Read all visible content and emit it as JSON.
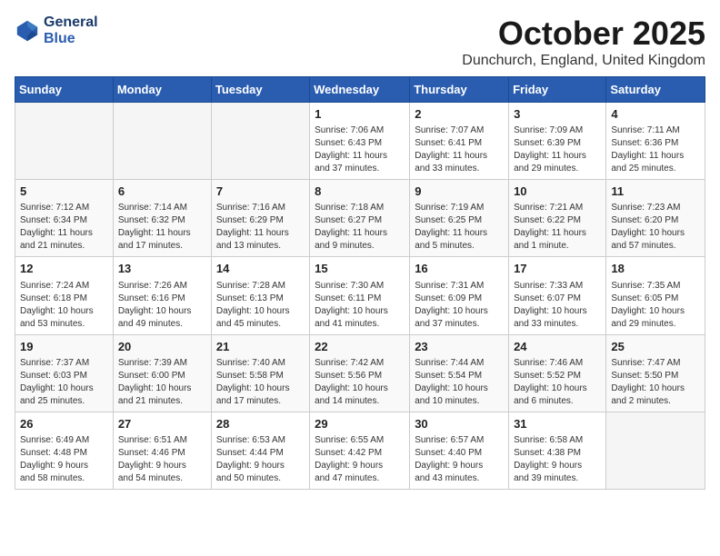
{
  "header": {
    "logo_line1": "General",
    "logo_line2": "Blue",
    "month": "October 2025",
    "location": "Dunchurch, England, United Kingdom"
  },
  "days_of_week": [
    "Sunday",
    "Monday",
    "Tuesday",
    "Wednesday",
    "Thursday",
    "Friday",
    "Saturday"
  ],
  "weeks": [
    [
      {
        "day": "",
        "info": ""
      },
      {
        "day": "",
        "info": ""
      },
      {
        "day": "",
        "info": ""
      },
      {
        "day": "1",
        "info": "Sunrise: 7:06 AM\nSunset: 6:43 PM\nDaylight: 11 hours\nand 37 minutes."
      },
      {
        "day": "2",
        "info": "Sunrise: 7:07 AM\nSunset: 6:41 PM\nDaylight: 11 hours\nand 33 minutes."
      },
      {
        "day": "3",
        "info": "Sunrise: 7:09 AM\nSunset: 6:39 PM\nDaylight: 11 hours\nand 29 minutes."
      },
      {
        "day": "4",
        "info": "Sunrise: 7:11 AM\nSunset: 6:36 PM\nDaylight: 11 hours\nand 25 minutes."
      }
    ],
    [
      {
        "day": "5",
        "info": "Sunrise: 7:12 AM\nSunset: 6:34 PM\nDaylight: 11 hours\nand 21 minutes."
      },
      {
        "day": "6",
        "info": "Sunrise: 7:14 AM\nSunset: 6:32 PM\nDaylight: 11 hours\nand 17 minutes."
      },
      {
        "day": "7",
        "info": "Sunrise: 7:16 AM\nSunset: 6:29 PM\nDaylight: 11 hours\nand 13 minutes."
      },
      {
        "day": "8",
        "info": "Sunrise: 7:18 AM\nSunset: 6:27 PM\nDaylight: 11 hours\nand 9 minutes."
      },
      {
        "day": "9",
        "info": "Sunrise: 7:19 AM\nSunset: 6:25 PM\nDaylight: 11 hours\nand 5 minutes."
      },
      {
        "day": "10",
        "info": "Sunrise: 7:21 AM\nSunset: 6:22 PM\nDaylight: 11 hours\nand 1 minute."
      },
      {
        "day": "11",
        "info": "Sunrise: 7:23 AM\nSunset: 6:20 PM\nDaylight: 10 hours\nand 57 minutes."
      }
    ],
    [
      {
        "day": "12",
        "info": "Sunrise: 7:24 AM\nSunset: 6:18 PM\nDaylight: 10 hours\nand 53 minutes."
      },
      {
        "day": "13",
        "info": "Sunrise: 7:26 AM\nSunset: 6:16 PM\nDaylight: 10 hours\nand 49 minutes."
      },
      {
        "day": "14",
        "info": "Sunrise: 7:28 AM\nSunset: 6:13 PM\nDaylight: 10 hours\nand 45 minutes."
      },
      {
        "day": "15",
        "info": "Sunrise: 7:30 AM\nSunset: 6:11 PM\nDaylight: 10 hours\nand 41 minutes."
      },
      {
        "day": "16",
        "info": "Sunrise: 7:31 AM\nSunset: 6:09 PM\nDaylight: 10 hours\nand 37 minutes."
      },
      {
        "day": "17",
        "info": "Sunrise: 7:33 AM\nSunset: 6:07 PM\nDaylight: 10 hours\nand 33 minutes."
      },
      {
        "day": "18",
        "info": "Sunrise: 7:35 AM\nSunset: 6:05 PM\nDaylight: 10 hours\nand 29 minutes."
      }
    ],
    [
      {
        "day": "19",
        "info": "Sunrise: 7:37 AM\nSunset: 6:03 PM\nDaylight: 10 hours\nand 25 minutes."
      },
      {
        "day": "20",
        "info": "Sunrise: 7:39 AM\nSunset: 6:00 PM\nDaylight: 10 hours\nand 21 minutes."
      },
      {
        "day": "21",
        "info": "Sunrise: 7:40 AM\nSunset: 5:58 PM\nDaylight: 10 hours\nand 17 minutes."
      },
      {
        "day": "22",
        "info": "Sunrise: 7:42 AM\nSunset: 5:56 PM\nDaylight: 10 hours\nand 14 minutes."
      },
      {
        "day": "23",
        "info": "Sunrise: 7:44 AM\nSunset: 5:54 PM\nDaylight: 10 hours\nand 10 minutes."
      },
      {
        "day": "24",
        "info": "Sunrise: 7:46 AM\nSunset: 5:52 PM\nDaylight: 10 hours\nand 6 minutes."
      },
      {
        "day": "25",
        "info": "Sunrise: 7:47 AM\nSunset: 5:50 PM\nDaylight: 10 hours\nand 2 minutes."
      }
    ],
    [
      {
        "day": "26",
        "info": "Sunrise: 6:49 AM\nSunset: 4:48 PM\nDaylight: 9 hours\nand 58 minutes."
      },
      {
        "day": "27",
        "info": "Sunrise: 6:51 AM\nSunset: 4:46 PM\nDaylight: 9 hours\nand 54 minutes."
      },
      {
        "day": "28",
        "info": "Sunrise: 6:53 AM\nSunset: 4:44 PM\nDaylight: 9 hours\nand 50 minutes."
      },
      {
        "day": "29",
        "info": "Sunrise: 6:55 AM\nSunset: 4:42 PM\nDaylight: 9 hours\nand 47 minutes."
      },
      {
        "day": "30",
        "info": "Sunrise: 6:57 AM\nSunset: 4:40 PM\nDaylight: 9 hours\nand 43 minutes."
      },
      {
        "day": "31",
        "info": "Sunrise: 6:58 AM\nSunset: 4:38 PM\nDaylight: 9 hours\nand 39 minutes."
      },
      {
        "day": "",
        "info": ""
      }
    ]
  ]
}
